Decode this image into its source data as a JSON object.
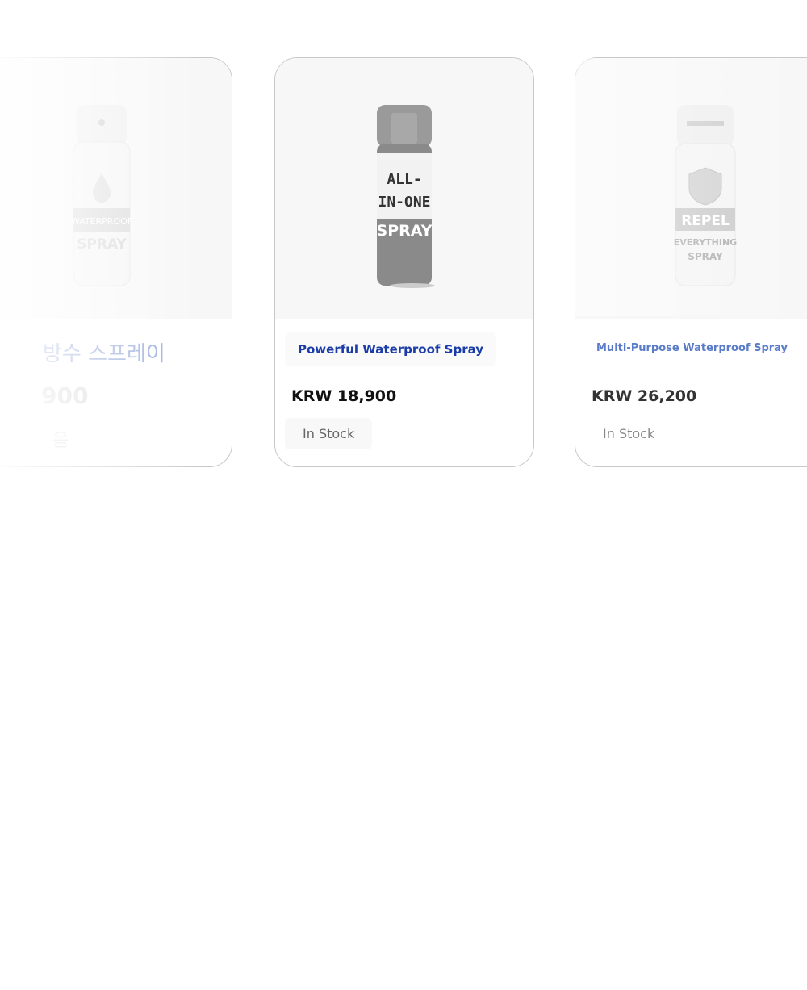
{
  "cards": [
    {
      "title": "방수 스프레이",
      "price": "900",
      "stock": "음",
      "bottle_text": [
        "WATERPROOF",
        "SPRAY"
      ],
      "icon": "droplet-icon"
    },
    {
      "title": "Powerful Waterproof Spray",
      "price": "KRW 18,900",
      "stock": "In Stock",
      "bottle_text": [
        "ALL-",
        "IN-ONE",
        "SPRAY"
      ],
      "icon": "spray-can-icon"
    },
    {
      "title": "Multi-Purpose Waterproof Spray",
      "price": "KRW 26,200",
      "stock": "In Stock",
      "bottle_text": [
        "REPEL",
        "EVERYTHING",
        "SPRAY"
      ],
      "icon": "shield-icon"
    }
  ],
  "colors": {
    "title_link": "#1a3ca8",
    "divider": "#2a9d8f",
    "card_border": "#c8c8c8"
  }
}
